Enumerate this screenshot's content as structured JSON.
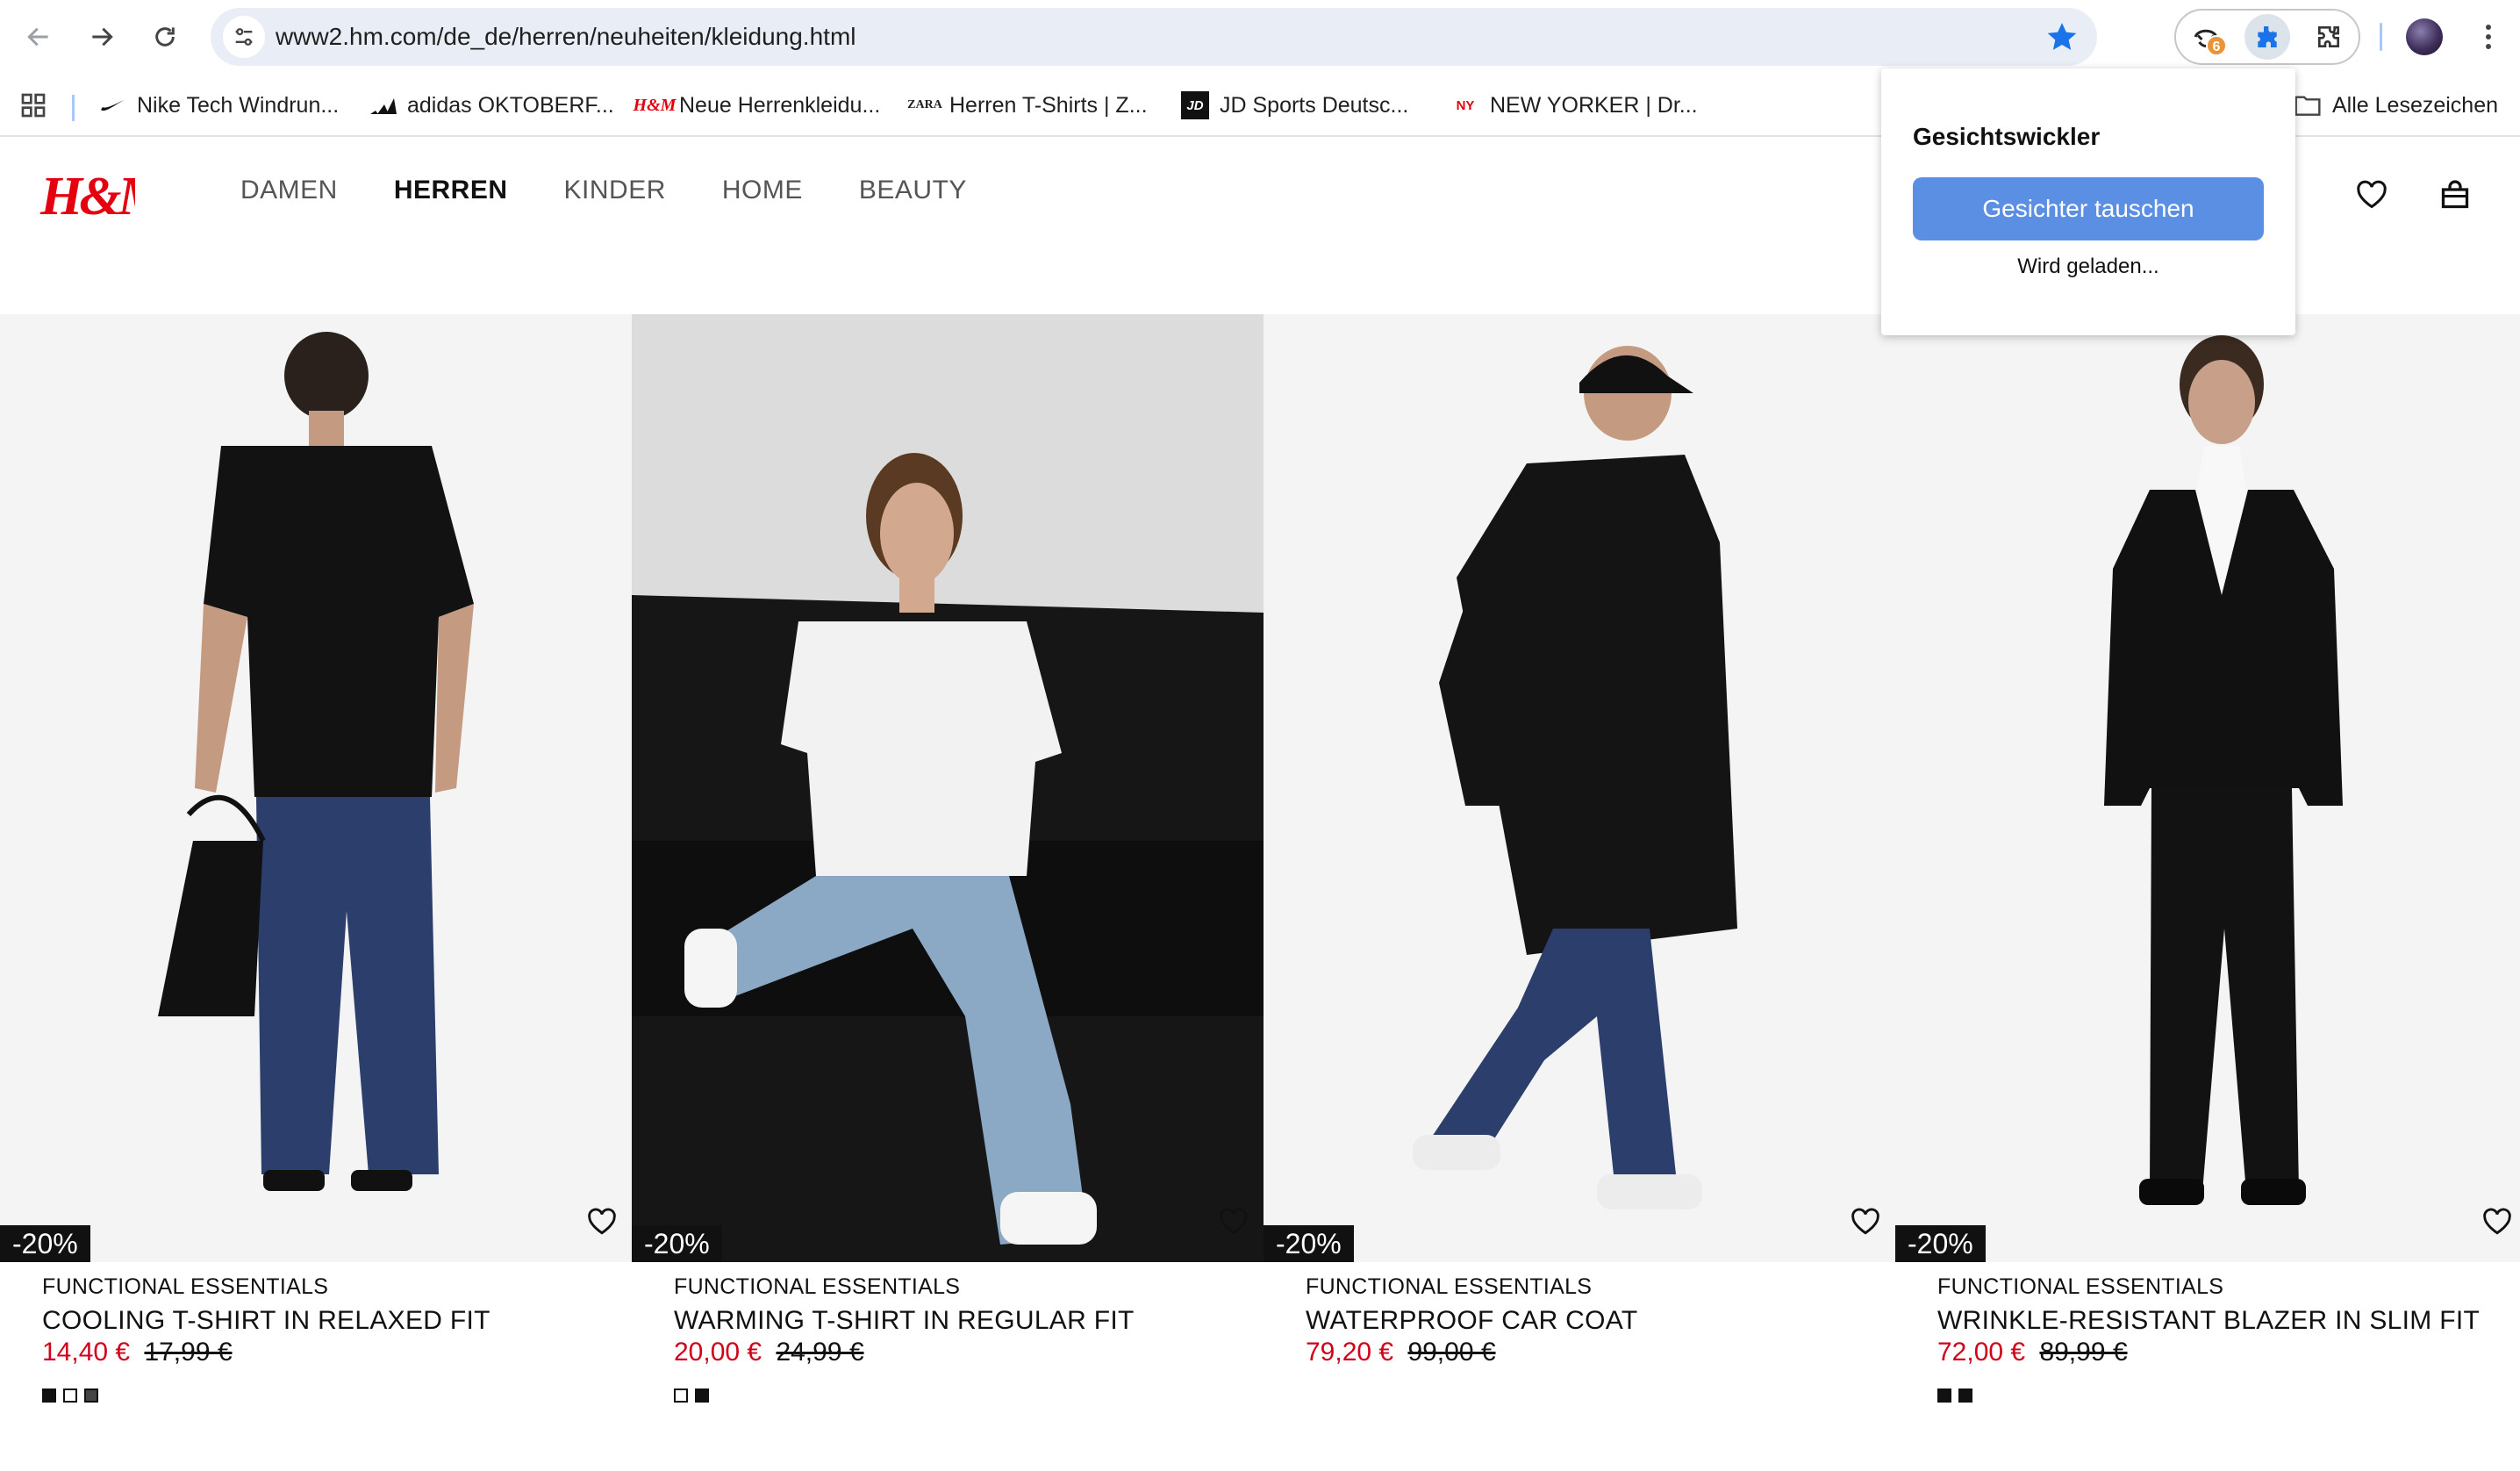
{
  "browser": {
    "url": "www2.hm.com/de_de/herren/neuheiten/kleidung.html",
    "extension_badge": "6",
    "bookmarks": [
      {
        "label": "Nike Tech Windrun...",
        "icon": "nike-swoosh-icon"
      },
      {
        "label": "adidas OKTOBERF...",
        "icon": "adidas-icon"
      },
      {
        "label": "Neue Herrenkleidu...",
        "icon": "hm-icon"
      },
      {
        "label": "Herren T-Shirts | Z...",
        "icon": "zara-icon"
      },
      {
        "label": "JD Sports Deutsc...",
        "icon": "jd-icon"
      },
      {
        "label": "NEW YORKER | Dr...",
        "icon": "new-yorker-icon"
      }
    ],
    "all_bookmarks_label": "Alle Lesezeichen"
  },
  "site": {
    "logo": "H&M",
    "nav": [
      "DAMEN",
      "HERREN",
      "KINDER",
      "HOME",
      "BEAUTY"
    ],
    "active_nav": "HERREN"
  },
  "products": [
    {
      "discount": "-20%",
      "brand": "FUNCTIONAL ESSENTIALS",
      "name": "COOLING T-SHIRT IN RELAXED FIT",
      "price": "14,40 €",
      "old_price": "17,99 €",
      "swatches": [
        "black",
        "white",
        "grey"
      ]
    },
    {
      "discount": "-20%",
      "brand": "FUNCTIONAL ESSENTIALS",
      "name": "WARMING T-SHIRT IN REGULAR FIT",
      "price": "20,00 €",
      "old_price": "24,99 €",
      "swatches": [
        "white",
        "black"
      ]
    },
    {
      "discount": "-20%",
      "brand": "FUNCTIONAL ESSENTIALS",
      "name": "WATERPROOF CAR COAT",
      "price": "79,20 €",
      "old_price": "99,00 €",
      "swatches": []
    },
    {
      "discount": "-20%",
      "brand": "FUNCTIONAL ESSENTIALS",
      "name": "WRINKLE-RESISTANT BLAZER IN SLIM FIT",
      "price": "72,00 €",
      "old_price": "89,99 €",
      "swatches": [
        "black",
        "black"
      ]
    }
  ],
  "popup": {
    "title": "Gesichtswickler",
    "button": "Gesichter tauschen",
    "status": "Wird geladen..."
  },
  "colors": {
    "sale_red": "#d0021b",
    "popup_button": "#5b8fe3",
    "omnibox": "#e9eef6",
    "hm_red": "#e50010"
  }
}
